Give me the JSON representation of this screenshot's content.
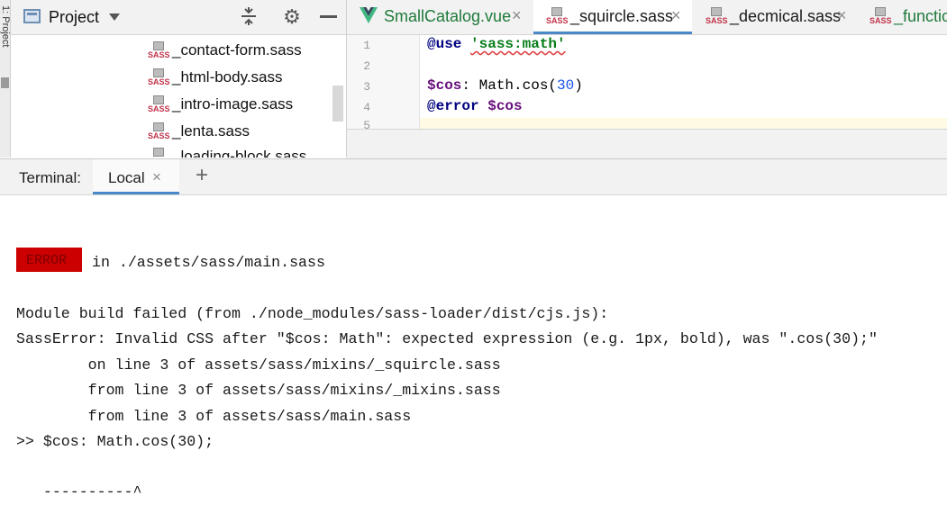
{
  "sidebar_strip": {
    "label": "1: Project"
  },
  "project": {
    "title": "Project",
    "files": [
      "_contact-form.sass",
      "_html-body.sass",
      "_intro-image.sass",
      "_lenta.sass",
      "_loading-block.sass"
    ],
    "file_icon_text": "SASS"
  },
  "editor": {
    "tabs": [
      {
        "label": "SmallCatalog.vue",
        "icon": "vue-icon",
        "close": "×"
      },
      {
        "label": "_squircle.sass",
        "icon": "sass-file-icon",
        "close": "×",
        "active": true
      },
      {
        "label": "_decmical.sass",
        "icon": "sass-file-icon",
        "close": "×"
      },
      {
        "label": "_functio",
        "icon": "sass-file-icon"
      }
    ],
    "line_numbers": [
      "1",
      "2",
      "3",
      "4",
      "5"
    ],
    "code": {
      "l1_kw": "@use",
      "l1_str": "'sass:math'",
      "l3_var": "$cos",
      "l3_colon": ": ",
      "l3_call": "Math.cos(",
      "l3_num": "30",
      "l3_close": ")",
      "l4_kw": "@error",
      "l4_var": "$cos"
    }
  },
  "terminal": {
    "title": "Terminal:",
    "tab_label": "Local",
    "tab_close": "×",
    "add_label": "+",
    "error_badge": "ERROR",
    "lines": {
      "error_location": "in ./assets/sass/main.sass",
      "build_failed": "Module build failed (from ./node_modules/sass-loader/dist/cjs.js):",
      "sass_error": "SassError: Invalid CSS after \"$cos: Math\": expected expression (e.g. 1px, bold), was \".cos(30);\"",
      "trace1": "        on line 3 of assets/sass/mixins/_squircle.sass",
      "trace2": "        from line 3 of assets/sass/mixins/_mixins.sass",
      "trace3": "        from line 3 of assets/sass/main.sass",
      "source": ">> $cos: Math.cos(30);",
      "pointer": "   ----------^"
    }
  },
  "colors": {
    "error_badge_bg": "#cc0000",
    "active_tab_underline": "#4a88c7",
    "sass_pink": "#c0334a",
    "vue_green": "#41b883",
    "string_green": "#067d17",
    "keyword_blue": "#000080",
    "variable_purple": "#660e7a"
  }
}
